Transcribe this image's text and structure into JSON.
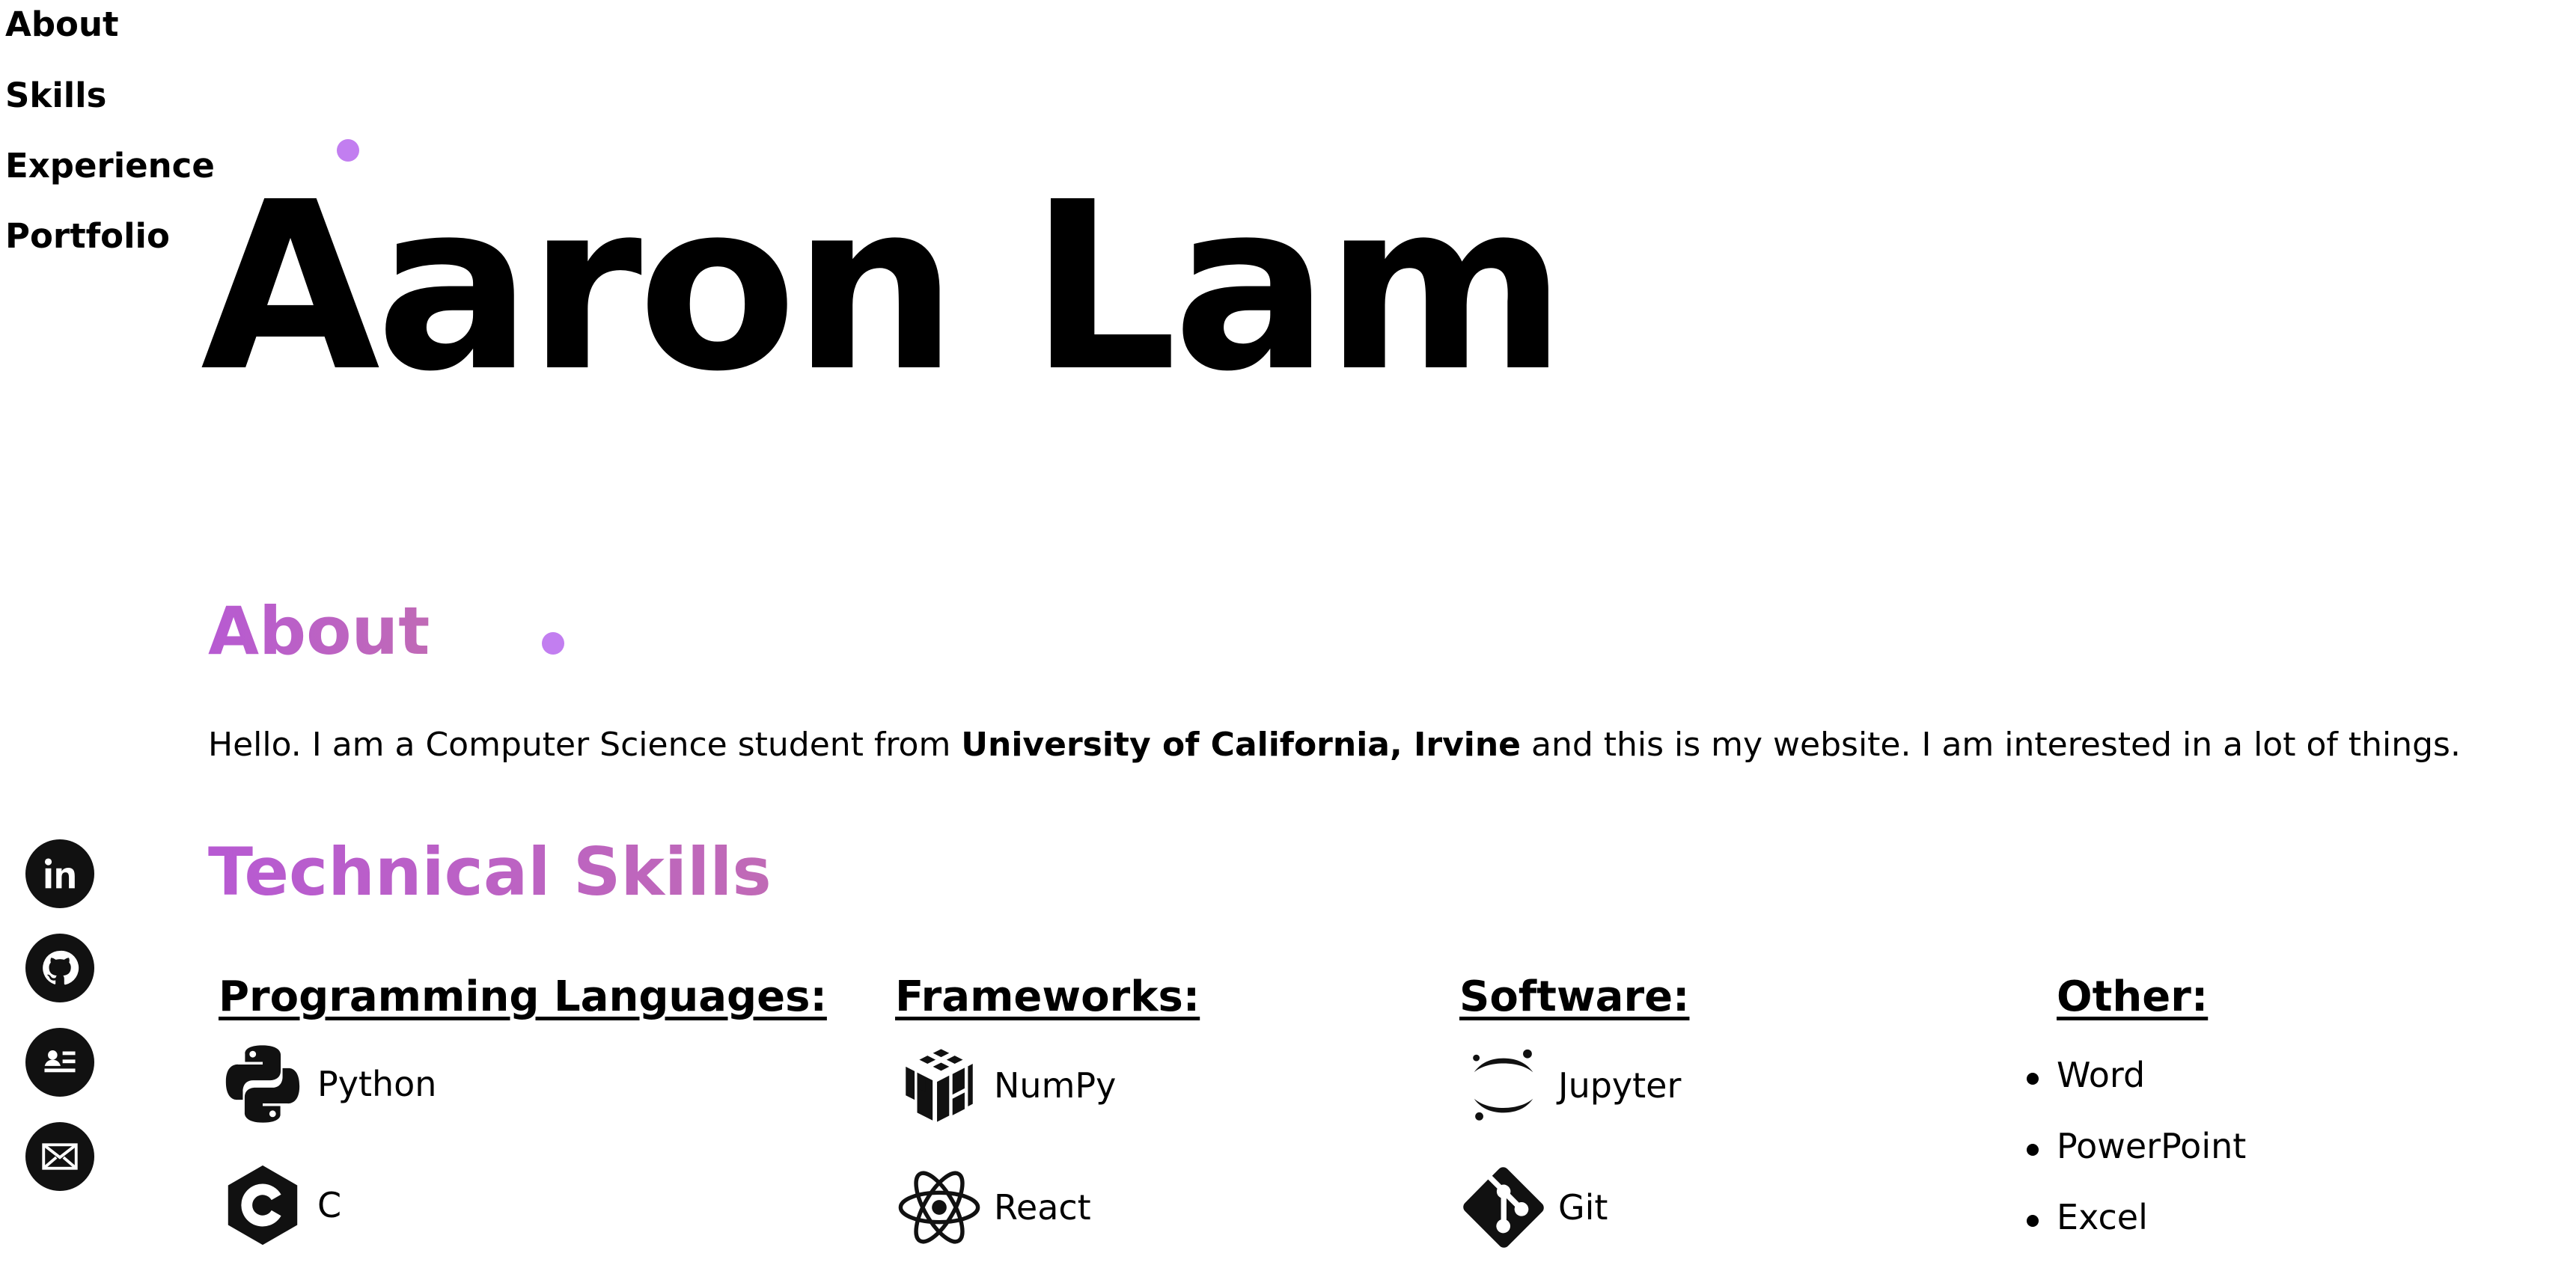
{
  "nav": {
    "items": [
      "About",
      "Skills",
      "Experience",
      "Portfolio"
    ]
  },
  "hero": {
    "name": "Aaron Lam"
  },
  "about": {
    "title": "About",
    "text_before": "Hello. I am a Computer Science student from ",
    "text_bold": "University of California, Irvine",
    "text_after": " and this is my website. I am interested in a lot of things."
  },
  "social": {
    "icons": [
      "linkedin-icon",
      "github-icon",
      "resume-icon",
      "email-icon"
    ]
  },
  "skills": {
    "title": "Technical Skills",
    "programming": {
      "heading": "Programming Languages:",
      "items": [
        {
          "label": "Python",
          "icon": "python-icon"
        },
        {
          "label": "C",
          "icon": "c-language-icon"
        }
      ]
    },
    "frameworks": {
      "heading": "Frameworks:",
      "items": [
        {
          "label": "NumPy",
          "icon": "numpy-icon"
        },
        {
          "label": "React",
          "icon": "react-icon"
        }
      ]
    },
    "software": {
      "heading": "Software:",
      "items": [
        {
          "label": "Jupyter",
          "icon": "jupyter-icon"
        },
        {
          "label": "Git",
          "icon": "git-icon"
        }
      ]
    },
    "other": {
      "heading": "Other:",
      "items": [
        "Word",
        "PowerPoint",
        "Excel"
      ]
    }
  },
  "colors": {
    "accent_dot": "#c27ef0",
    "heading_gradient_start": "#b75ad2",
    "heading_gradient_end": "#c06ab6"
  }
}
